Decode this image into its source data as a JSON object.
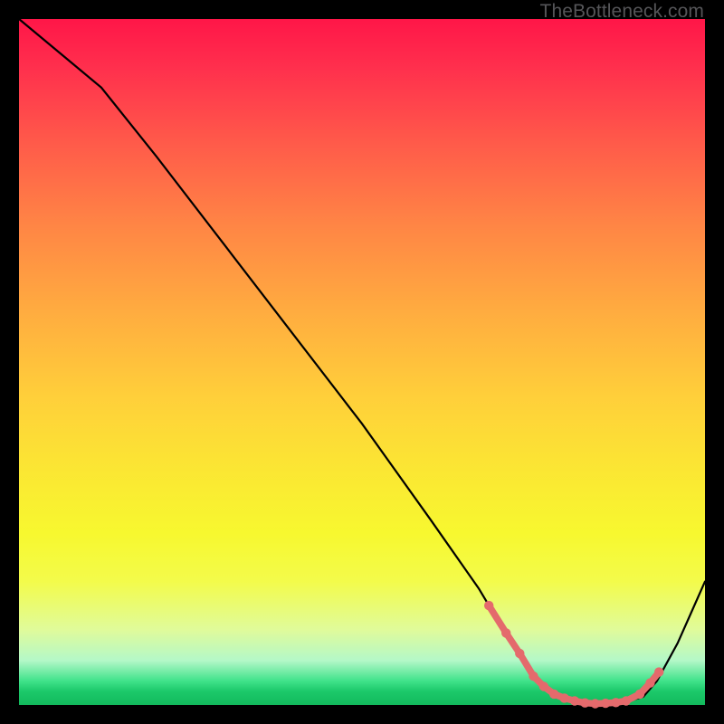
{
  "watermark": "TheBottleneck.com",
  "chart_data": {
    "type": "line",
    "title": "",
    "xlabel": "",
    "ylabel": "",
    "xlim": [
      0,
      100
    ],
    "ylim": [
      0,
      100
    ],
    "grid": false,
    "series": [
      {
        "name": "bottleneck-curve",
        "x": [
          0,
          6,
          12,
          20,
          30,
          40,
          50,
          60,
          67,
          70,
          73,
          76,
          80,
          84,
          88,
          91,
          93,
          96,
          100
        ],
        "y": [
          100,
          95,
          90,
          80,
          67,
          54,
          41,
          27,
          17,
          12,
          7,
          3,
          0.6,
          0.2,
          0.3,
          1.2,
          3.5,
          9,
          18
        ]
      }
    ],
    "markers": {
      "name": "highlight-dots",
      "color": "#e46a6c",
      "x": [
        68.5,
        71,
        73,
        75,
        76.5,
        78,
        79.5,
        81,
        82.5,
        84,
        85.5,
        87,
        88.5,
        90.5,
        92,
        93.3
      ],
      "y": [
        14.5,
        10.5,
        7.5,
        4.2,
        2.7,
        1.6,
        1.0,
        0.6,
        0.3,
        0.2,
        0.25,
        0.35,
        0.6,
        1.6,
        3.2,
        4.8
      ]
    }
  }
}
